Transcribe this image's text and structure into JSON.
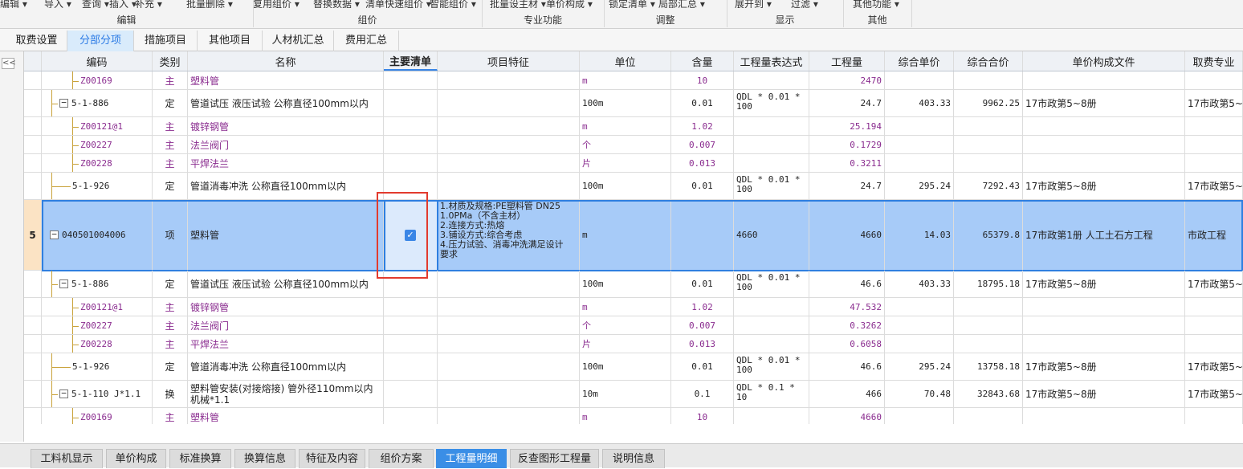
{
  "ribbon": {
    "buttons": [
      "编辑",
      "导入",
      "查询",
      "插入",
      "补充",
      "批量删除",
      "复用组价",
      "替换数据",
      "清单快速组价",
      "智能组价",
      "批量设主材",
      "单价构成",
      "锁定清单",
      "局部汇总",
      "展开到",
      "过滤",
      "其他功能"
    ],
    "groups": [
      "编辑",
      "组价",
      "专业功能",
      "调整",
      "显示",
      "其他"
    ]
  },
  "tabs": [
    "取费设置",
    "分部分项",
    "措施项目",
    "其他项目",
    "人材机汇总",
    "费用汇总"
  ],
  "active_tab": "分部分项",
  "collapse_label": "<<",
  "columns": [
    "编码",
    "类别",
    "名称",
    "主要清单",
    "项目特征",
    "单位",
    "含量",
    "工程量表达式",
    "工程量",
    "综合单价",
    "综合合价",
    "单价构成文件",
    "取费专业"
  ],
  "rows": [
    {
      "code": "Z00169",
      "type": "主",
      "name": "塑料管",
      "feature": "",
      "unit": "m",
      "content": "10",
      "expr": "",
      "qty": "2470",
      "uprice": "",
      "total": "",
      "file": "",
      "prof": "",
      "kind": "main"
    },
    {
      "code": "5-1-886",
      "type": "定",
      "name": "管道试压 液压试验 公称直径100mm以内",
      "feature": "",
      "unit": "100m",
      "content": "0.01",
      "expr": "QDL * 0.01 * 100",
      "qty": "24.7",
      "uprice": "403.33",
      "total": "9962.25",
      "file": "17市政第5~8册",
      "prof": "17市政第5~8册",
      "kind": "quota",
      "toggle": "−"
    },
    {
      "code": "Z00121@1",
      "type": "主",
      "name": "镀锌钢管",
      "feature": "",
      "unit": "m",
      "content": "1.02",
      "expr": "",
      "qty": "25.194",
      "uprice": "",
      "total": "",
      "file": "",
      "prof": "",
      "kind": "main"
    },
    {
      "code": "Z00227",
      "type": "主",
      "name": "法兰阀门",
      "feature": "",
      "unit": "个",
      "content": "0.007",
      "expr": "",
      "qty": "0.1729",
      "uprice": "",
      "total": "",
      "file": "",
      "prof": "",
      "kind": "main"
    },
    {
      "code": "Z00228",
      "type": "主",
      "name": "平焊法兰",
      "feature": "",
      "unit": "片",
      "content": "0.013",
      "expr": "",
      "qty": "0.3211",
      "uprice": "",
      "total": "",
      "file": "",
      "prof": "",
      "kind": "main"
    },
    {
      "code": "5-1-926",
      "type": "定",
      "name": "管道消毒冲洗 公称直径100mm以内",
      "feature": "",
      "unit": "100m",
      "content": "0.01",
      "expr": "QDL * 0.01 * 100",
      "qty": "24.7",
      "uprice": "295.24",
      "total": "7292.43",
      "file": "17市政第5~8册",
      "prof": "17市政第5~8册",
      "kind": "quota"
    },
    {
      "num": "5",
      "code": "040501004006",
      "type": "项",
      "name": "塑料管",
      "feature": [
        "1.材质及规格:PE塑料管  DN25",
        "1.0PMa（不含主材）",
        "2.连接方式:热熔",
        "3.铺设方式:综合考虑",
        "4.压力试验、消毒冲洗满足设计",
        "要求"
      ],
      "main_list": true,
      "unit": "m",
      "content": "",
      "expr": "4660",
      "qty": "4660",
      "uprice": "14.03",
      "total": "65379.8",
      "file": "17市政第1册   人工土石方工程",
      "prof": "市政工程",
      "kind": "item",
      "toggle": "−"
    },
    {
      "code": "5-1-886",
      "type": "定",
      "name": "管道试压 液压试验 公称直径100mm以内",
      "feature": "",
      "unit": "100m",
      "content": "0.01",
      "expr": "QDL * 0.01 * 100",
      "qty": "46.6",
      "uprice": "403.33",
      "total": "18795.18",
      "file": "17市政第5~8册",
      "prof": "17市政第5~8册",
      "kind": "quota",
      "toggle": "−"
    },
    {
      "code": "Z00121@1",
      "type": "主",
      "name": "镀锌钢管",
      "feature": "",
      "unit": "m",
      "content": "1.02",
      "expr": "",
      "qty": "47.532",
      "uprice": "",
      "total": "",
      "file": "",
      "prof": "",
      "kind": "main"
    },
    {
      "code": "Z00227",
      "type": "主",
      "name": "法兰阀门",
      "feature": "",
      "unit": "个",
      "content": "0.007",
      "expr": "",
      "qty": "0.3262",
      "uprice": "",
      "total": "",
      "file": "",
      "prof": "",
      "kind": "main"
    },
    {
      "code": "Z00228",
      "type": "主",
      "name": "平焊法兰",
      "feature": "",
      "unit": "片",
      "content": "0.013",
      "expr": "",
      "qty": "0.6058",
      "uprice": "",
      "total": "",
      "file": "",
      "prof": "",
      "kind": "main"
    },
    {
      "code": "5-1-926",
      "type": "定",
      "name": "管道消毒冲洗 公称直径100mm以内",
      "feature": "",
      "unit": "100m",
      "content": "0.01",
      "expr": "QDL * 0.01 * 100",
      "qty": "46.6",
      "uprice": "295.24",
      "total": "13758.18",
      "file": "17市政第5~8册",
      "prof": "17市政第5~8册",
      "kind": "quota"
    },
    {
      "code": "5-1-110 J*1.1",
      "type": "换",
      "name": "塑料管安装(对接熔接) 管外径110mm以内 机械*1.1",
      "feature": "",
      "unit": "10m",
      "content": "0.1",
      "expr": "QDL * 0.1 * 10",
      "qty": "466",
      "uprice": "70.48",
      "total": "32843.68",
      "file": "17市政第5~8册",
      "prof": "17市政第5~8册",
      "kind": "quota",
      "toggle": "−"
    },
    {
      "code": "Z00169",
      "type": "主",
      "name": "塑料管",
      "feature": "",
      "unit": "m",
      "content": "10",
      "expr": "",
      "qty": "4660",
      "uprice": "",
      "total": "",
      "file": "",
      "prof": "",
      "kind": "main"
    }
  ],
  "bottom_tabs": [
    "工料机显示",
    "单价构成",
    "标准换算",
    "换算信息",
    "特征及内容",
    "组价方案",
    "工程量明细",
    "反查图形工程量",
    "说明信息"
  ],
  "active_bottom_tab": "工程量明细"
}
